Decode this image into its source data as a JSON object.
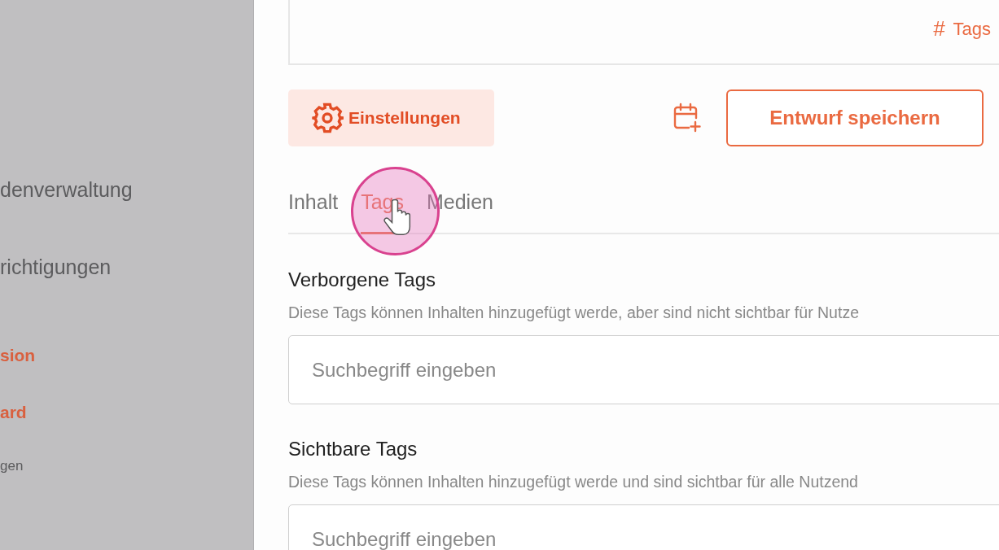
{
  "sidebar": {
    "items": [
      {
        "label": "denverwaltung",
        "kind": "nav"
      },
      {
        "label": "richtigungen",
        "kind": "nav"
      },
      {
        "label": "sion",
        "kind": "link"
      },
      {
        "label": "ard",
        "kind": "link"
      },
      {
        "label": "gen",
        "kind": "small"
      }
    ]
  },
  "editor_card": {
    "tags_button": {
      "symbol": "#",
      "label": "Tags"
    }
  },
  "toolbar": {
    "settings_button": "Einstellungen",
    "save_button": "Entwurf speichern"
  },
  "tabs": [
    {
      "label": "Inhalt",
      "selected": false
    },
    {
      "label": "Tags",
      "selected": true
    },
    {
      "label": "Medien",
      "selected": false
    }
  ],
  "sections": [
    {
      "heading": "Verborgene Tags",
      "description": "Diese Tags können Inhalten hinzugefügt werde, aber sind nicht sichtbar für Nutze",
      "placeholder": "Suchbegriff eingeben"
    },
    {
      "heading": "Sichtbare Tags",
      "description": "Diese Tags können Inhalten hinzugefügt werde und sind sichtbar für alle Nutzend",
      "placeholder": "Suchbegriff eingeben"
    }
  ]
}
